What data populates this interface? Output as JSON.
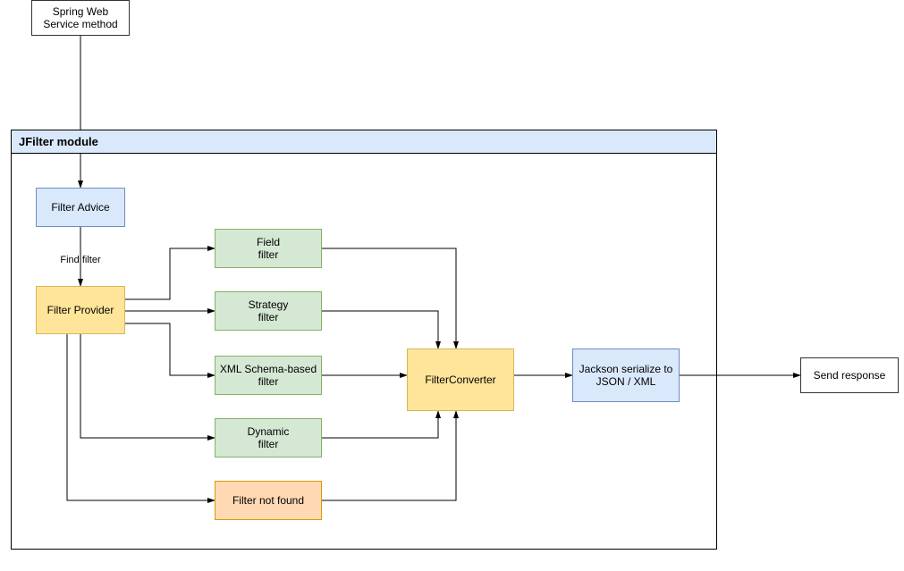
{
  "chart_data": {
    "type": "flowchart",
    "module_title": "JFilter module",
    "nodes": [
      {
        "id": "spring",
        "label": "Spring Web Service\nmethod",
        "class": "white"
      },
      {
        "id": "advice",
        "label": "Filter Advice",
        "class": "blue"
      },
      {
        "id": "provider",
        "label": "Filter Provider",
        "class": "yellow"
      },
      {
        "id": "field",
        "label": "Field\nfilter",
        "class": "green"
      },
      {
        "id": "strategy",
        "label": "Strategy\nfilter",
        "class": "green"
      },
      {
        "id": "xml",
        "label": "XML Schema-based\nfilter",
        "class": "green"
      },
      {
        "id": "dynamic",
        "label": "Dynamic\nfilter",
        "class": "green"
      },
      {
        "id": "notfound",
        "label": "Filter not found",
        "class": "orange"
      },
      {
        "id": "converter",
        "label": "FilterConverter",
        "class": "yellow"
      },
      {
        "id": "jackson",
        "label": "Jackson serialize to\nJSON / XML",
        "class": "blue"
      },
      {
        "id": "send",
        "label": "Send response",
        "class": "white"
      }
    ],
    "edges": [
      {
        "from": "spring",
        "to": "advice"
      },
      {
        "from": "advice",
        "to": "provider",
        "label": "Find filter"
      },
      {
        "from": "provider",
        "to": "field"
      },
      {
        "from": "provider",
        "to": "strategy"
      },
      {
        "from": "provider",
        "to": "xml"
      },
      {
        "from": "provider",
        "to": "dynamic"
      },
      {
        "from": "provider",
        "to": "notfound"
      },
      {
        "from": "field",
        "to": "converter"
      },
      {
        "from": "strategy",
        "to": "converter"
      },
      {
        "from": "xml",
        "to": "converter"
      },
      {
        "from": "dynamic",
        "to": "converter"
      },
      {
        "from": "notfound",
        "to": "converter"
      },
      {
        "from": "converter",
        "to": "jackson"
      },
      {
        "from": "jackson",
        "to": "send"
      }
    ]
  },
  "labels": {
    "module_title": "JFilter module",
    "spring": "Spring Web Service method",
    "advice": "Filter Advice",
    "find_filter": "Find filter",
    "provider": "Filter Provider",
    "field_l1": "Field",
    "field_l2": "filter",
    "strategy_l1": "Strategy",
    "strategy_l2": "filter",
    "xml_l1": "XML Schema-based",
    "xml_l2": "filter",
    "dynamic_l1": "Dynamic",
    "dynamic_l2": "filter",
    "notfound": "Filter not found",
    "converter": "FilterConverter",
    "jackson_l1": "Jackson serialize to",
    "jackson_l2": "JSON / XML",
    "send": "Send response"
  }
}
